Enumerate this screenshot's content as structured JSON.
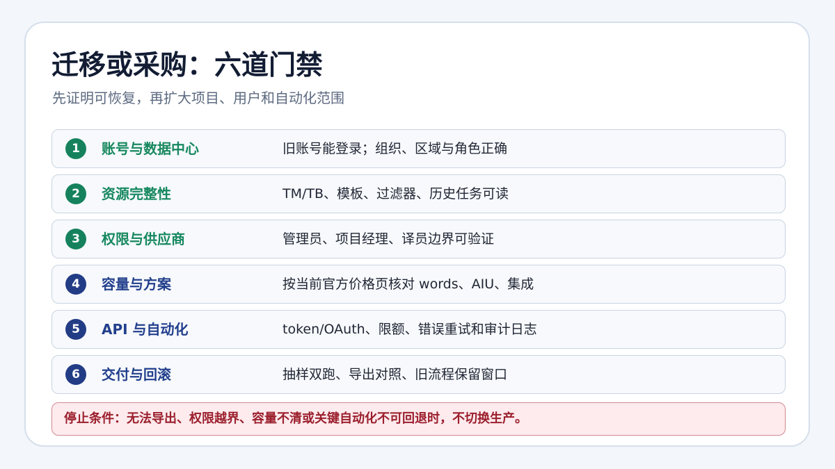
{
  "slide": {
    "title": "迁移或采购：六道门禁",
    "subtitle": "先证明可恢复，再扩大项目、用户和自动化范围",
    "colors": {
      "green": "#17885f",
      "blue": "#223f8c",
      "warning_text": "#9b1f2c",
      "warning_bg": "#fdebee"
    },
    "rows": [
      {
        "number": "1",
        "title": "账号与数据中心",
        "description": "旧账号能登录；组织、区域与角色正确"
      },
      {
        "number": "2",
        "title": "资源完整性",
        "description": "TM/TB、模板、过滤器、历史任务可读"
      },
      {
        "number": "3",
        "title": "权限与供应商",
        "description": "管理员、项目经理、译员边界可验证"
      },
      {
        "number": "4",
        "title": "容量与方案",
        "description": "按当前官方价格页核对 words、AIU、集成"
      },
      {
        "number": "5",
        "title": "API 与自动化",
        "description": "token/OAuth、限额、错误重试和审计日志"
      },
      {
        "number": "6",
        "title": "交付与回滚",
        "description": "抽样双跑、导出对照、旧流程保留窗口"
      }
    ],
    "warning": "停止条件：无法导出、权限越界、容量不清或关键自动化不可回退时，不切换生产。"
  }
}
